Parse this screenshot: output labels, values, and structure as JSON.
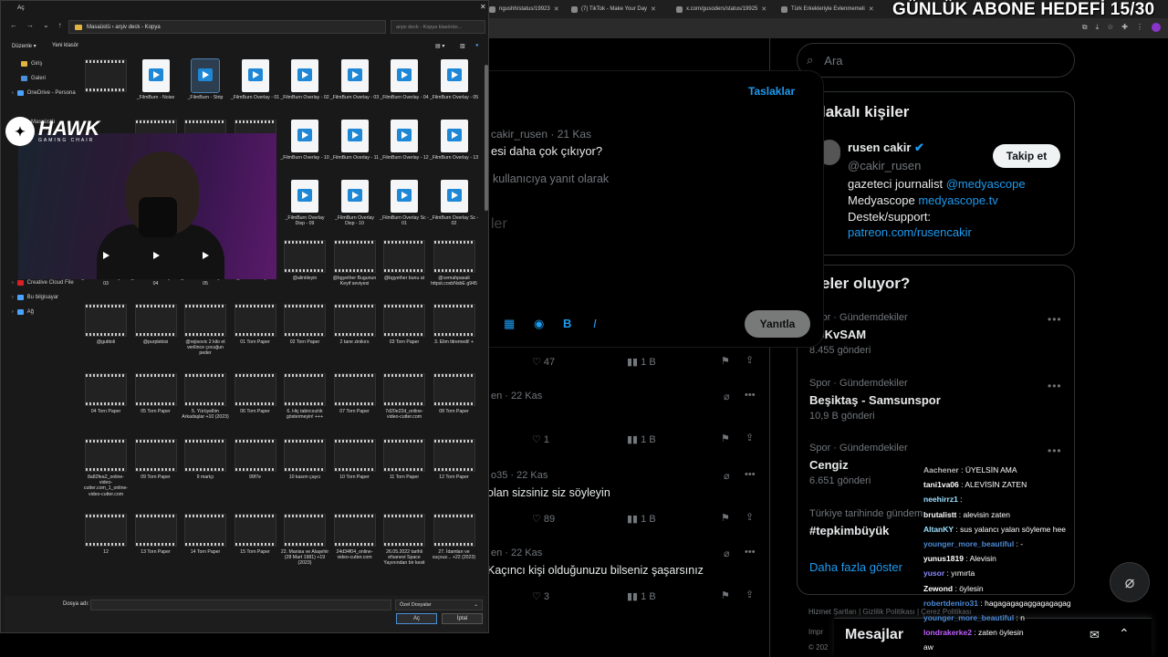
{
  "overlay": {
    "goal": "GÜNLÜK ABONE HEDEFİ 15/30"
  },
  "browser": {
    "tabs": [
      {
        "label": "ngushh/status/19923"
      },
      {
        "label": "(7) TikTok - Make Your Day"
      },
      {
        "label": "x.com/gusoders/status/19925"
      },
      {
        "label": "Türk Erkekleriyle Evlenmemeli"
      }
    ]
  },
  "twitter": {
    "search_placeholder": "Ara",
    "drafts": "Taslaklar",
    "quoted_handle": "cakir_rusen · 21 Kas",
    "quoted_text": "esi daha çok çıkıyor?",
    "reply_to": "kullanıcıya yanıt olarak",
    "placeholder": "ler",
    "reply_button": "Yanıtla",
    "feed": [
      {
        "likes": "47",
        "views": "1 B",
        "handle": "",
        "text": ""
      },
      {
        "handle": "en · 22 Kas",
        "likes": "1",
        "views": "1 B",
        "text": ""
      },
      {
        "handle": "o35 · 22 Kas",
        "text": "olan sizsiniz siz söyleyin",
        "likes": "89",
        "views": "1 B"
      },
      {
        "handle": "en · 22 Kas",
        "text": "Kaçıncı kişi olduğunuzu bilseniz şaşarsınız",
        "likes": "3",
        "views": "1 B"
      }
    ],
    "related_title": "lakalı kişiler",
    "profile": {
      "name": "rusen cakir",
      "handle": "@cakir_rusen",
      "follow": "Takip et",
      "bio1": "gazeteci journalist",
      "bio1_link": "@medyascope",
      "bio2": "Medyascope",
      "bio2_link": "medyascope.tv",
      "bio3": "Destek/support:",
      "bio4_link": "patreon.com/rusencakir"
    },
    "trends_title": "eler oluyor?",
    "trends": [
      {
        "cat": "Spor · Gündemdekiler",
        "name": "BJKvSAM",
        "count": "8.455 gönderi"
      },
      {
        "cat": "Spor · Gündemdekiler",
        "name": "Beşiktaş - Samsunspor",
        "count": "10,9 B gönderi"
      },
      {
        "cat": "Spor · Gündemdekiler",
        "name": "Cengiz",
        "count": "6.651 gönderi"
      },
      {
        "cat": "Türkiye tarihinde gündem",
        "name": "#tepkimbüyük",
        "count": ""
      }
    ],
    "show_more": "Daha fazla göster",
    "footer1": "Hizmet Şartları  |  Gizlilik Politikası  |  Çerez Politikası",
    "footer2": "Impr",
    "footer3": "© 202",
    "messages": "Mesajlar"
  },
  "chat": [
    {
      "user": "Aachener",
      "msg": "ÜYELSİN AMA",
      "color": "#ffffff"
    },
    {
      "user": "tani1va06",
      "msg": "ALEVİSİN ZATEN",
      "color": "#ffffff"
    },
    {
      "user": "neehirrz1",
      "msg": "",
      "color": "#ffffff"
    },
    {
      "user": "brutalistt",
      "msg": "alevisin zaten",
      "color": "#ffffff"
    },
    {
      "user": "AltanKY",
      "msg": "sus yalancı yalan söyleme hee",
      "color": "#ffffff"
    },
    {
      "user": "younger_more_beautiful",
      "msg": "-",
      "color": "#ffffff"
    },
    {
      "user": "yunus1819",
      "msg": "Alevisin",
      "color": "#ffffff"
    },
    {
      "user": "yusor",
      "msg": "yımırta",
      "color": "#ffffff"
    },
    {
      "user": "Zewond",
      "msg": "öylesin",
      "color": "#ffffff"
    },
    {
      "user": "robertdeniro31",
      "msg": "hagagagagaggagagagag",
      "color": "#ffffff"
    },
    {
      "user": "younger_more_beautiful",
      "msg": "n",
      "color": "#ffffff"
    },
    {
      "user": "londrakerke2",
      "msg": "zaten öylesin",
      "color": "#ffffff"
    },
    {
      "user": "",
      "msg": "aw",
      "color": "#ffffff"
    }
  ],
  "chat_colors": [
    "#b7b7b7",
    "#ffffff",
    "#9be0ff",
    "#ffffff",
    "#9be0ff",
    "#4b8bd6",
    "#ffffff",
    "#8a8aff",
    "#ffffff",
    "#4b8bd6",
    "#4b8bd6",
    "#c060ff",
    "#ffffff"
  ],
  "dialog": {
    "title": "Aç",
    "path": "Masaüstü  ›  arşiv deck - Kopya",
    "search": "arşiv deck - Kopya klasörün...",
    "organize": "Düzenle ▾",
    "new_folder": "Yeni klasör",
    "nav": [
      "Giriş",
      "Galeri",
      "OneDrive - Persona",
      "Masaüstü",
      "Creative Cloud File",
      "Bu bilgisayar",
      "Ağ"
    ],
    "files": [
      [
        "",
        "_FilmBurn - Noise",
        "_FilmBurn - Strip",
        "_FilmBurn Overlay - 01",
        "_FilmBurn Overlay - 02",
        "_FilmBurn Overlay - 03",
        "_FilmBurn Overlay - 04",
        "_FilmBurn Overlay - 05"
      ],
      [
        "",
        "",
        "",
        "_FilmBurn Overlay - 10",
        "_FilmBurn Overlay - 11",
        "_FilmBurn Overlay - 12",
        "_FilmBurn Overlay - 13"
      ],
      [
        "",
        "",
        "",
        "_FilmBurn Overlay Disp - 09",
        "_FilmBurn Overlay Disp - 10",
        "_FilmBurn Overlay Sc - 01",
        "_FilmBurn Overlay Sc - 02"
      ],
      [
        "_FilmBurn Overlay Sc - 03",
        "_FilmBurn Overlay Sc - 04",
        "_FilmBurn Overlay Sc - 05",
        "_VHS Overlay 07",
        "@alintileyin",
        "@bgyether Bugunun Keyif seviyesi",
        "@bgyether bunu at",
        "@cemahpasali httpst.coxbNsbE g945"
      ],
      [
        "@gutitoli",
        "@purplebisi",
        "@rejisovic 2 kilo et verilince çocuğun peder",
        "01 Torn Paper",
        "02 Torn Paper",
        "2 tane zinikırs",
        "03 Torn Paper",
        "3. Elim titremedi! +"
      ],
      [
        "04 Torn Paper",
        "05 Torn Paper",
        "5. Yürüyellim Arkadaşlar +10 (2023)",
        "06 Torn Paper",
        "6. Hiç tabircsızlık göstermeyin! +++",
        "07 Torn Paper",
        "7d20e22d_online-video-cutter.com",
        "08 Torn Paper"
      ],
      [
        "8a82fea2_online-video-cutter.com_1_online-video-cutter.com",
        "09 Torn Paper",
        "9 martçı",
        "99f7e",
        "10 kasım çaycı",
        "10 Torn Paper",
        "11 Torn Paper",
        "12 Torn Paper"
      ],
      [
        "12",
        "13 Torn Paper",
        "14 Torn Paper",
        "15 Torn Paper",
        "22. Manisa ve Alaşehir (28 Mart 1981) +19 (2023)",
        "24d34f04_online-video-cutter.com",
        "26.05.2022 tarihli efsanevi Space Yayınından bir kesit",
        "27. İdamları ve suçsuz... +22 (2023)"
      ]
    ],
    "filename_label": "Dosya adı:",
    "filetype": "Özel Dosyalar",
    "open": "Aç",
    "cancel": "İptal"
  },
  "webcam": {
    "brand": "HAWK",
    "brand_sub": "GAMING CHAIR"
  }
}
